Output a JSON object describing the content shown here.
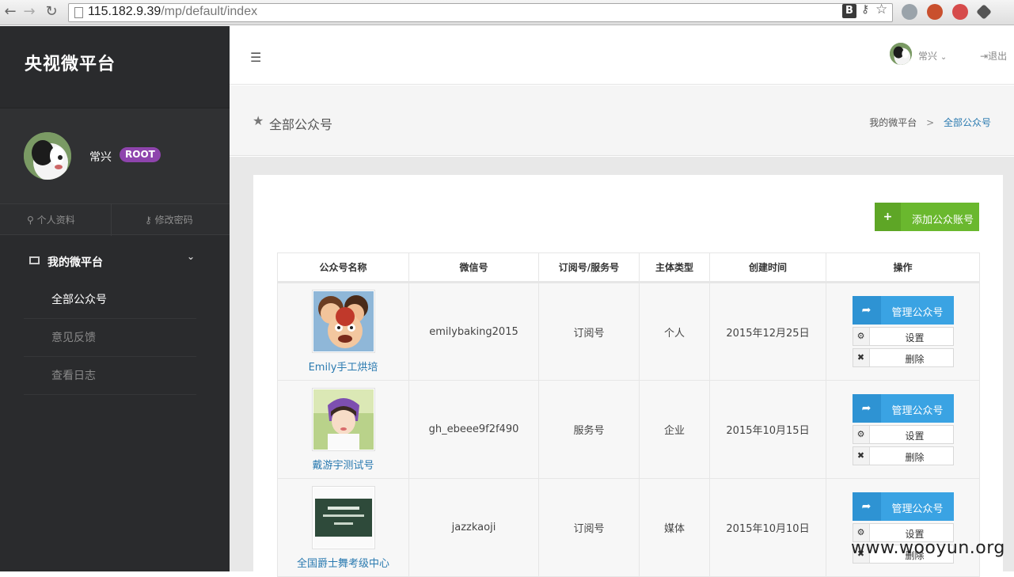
{
  "browser": {
    "url_host": "115.182.9.39",
    "url_path": "/mp/default/index"
  },
  "sidebar": {
    "brand": "央视微平台",
    "user": {
      "name": "常兴",
      "badge": "ROOT"
    },
    "links": {
      "profile": "个人资料",
      "password": "修改密码"
    },
    "menu": {
      "title": "我的微平台",
      "items": [
        {
          "label": "全部公众号",
          "active": true
        },
        {
          "label": "意见反馈",
          "active": false
        },
        {
          "label": "查看日志",
          "active": false
        }
      ]
    }
  },
  "topbar": {
    "username": "常兴",
    "logout": "退出"
  },
  "page": {
    "title": "全部公众号",
    "breadcrumb": {
      "root": "我的微平台",
      "sep": ">",
      "current": "全部公众号"
    }
  },
  "toolbar": {
    "add_button": "添加公众账号"
  },
  "table": {
    "headers": [
      "公众号名称",
      "微信号",
      "订阅号/服务号",
      "主体类型",
      "创建时间",
      "操作"
    ],
    "rows": [
      {
        "name": "Emily手工烘培",
        "wechat_id": "emilybaking2015",
        "type": "订阅号",
        "entity": "个人",
        "created": "2015年12月25日"
      },
      {
        "name": "戴游宇测试号",
        "wechat_id": "gh_ebeee9f2f490",
        "type": "服务号",
        "entity": "企业",
        "created": "2015年10月15日"
      },
      {
        "name": "全国爵士舞考级中心",
        "wechat_id": "jazzkaoji",
        "type": "订阅号",
        "entity": "媒体",
        "created": "2015年10月10日"
      }
    ],
    "actions": {
      "manage": "管理公众号",
      "settings": "设置",
      "delete": "删除"
    }
  },
  "watermark": "www.wooyun.org",
  "colors": {
    "sidebar_bg": "#2a2b2d",
    "accent_blue": "#3aa3e3",
    "add_green": "#6ab82e",
    "badge_purple": "#8e44ad",
    "link_blue": "#2a7ab0"
  }
}
